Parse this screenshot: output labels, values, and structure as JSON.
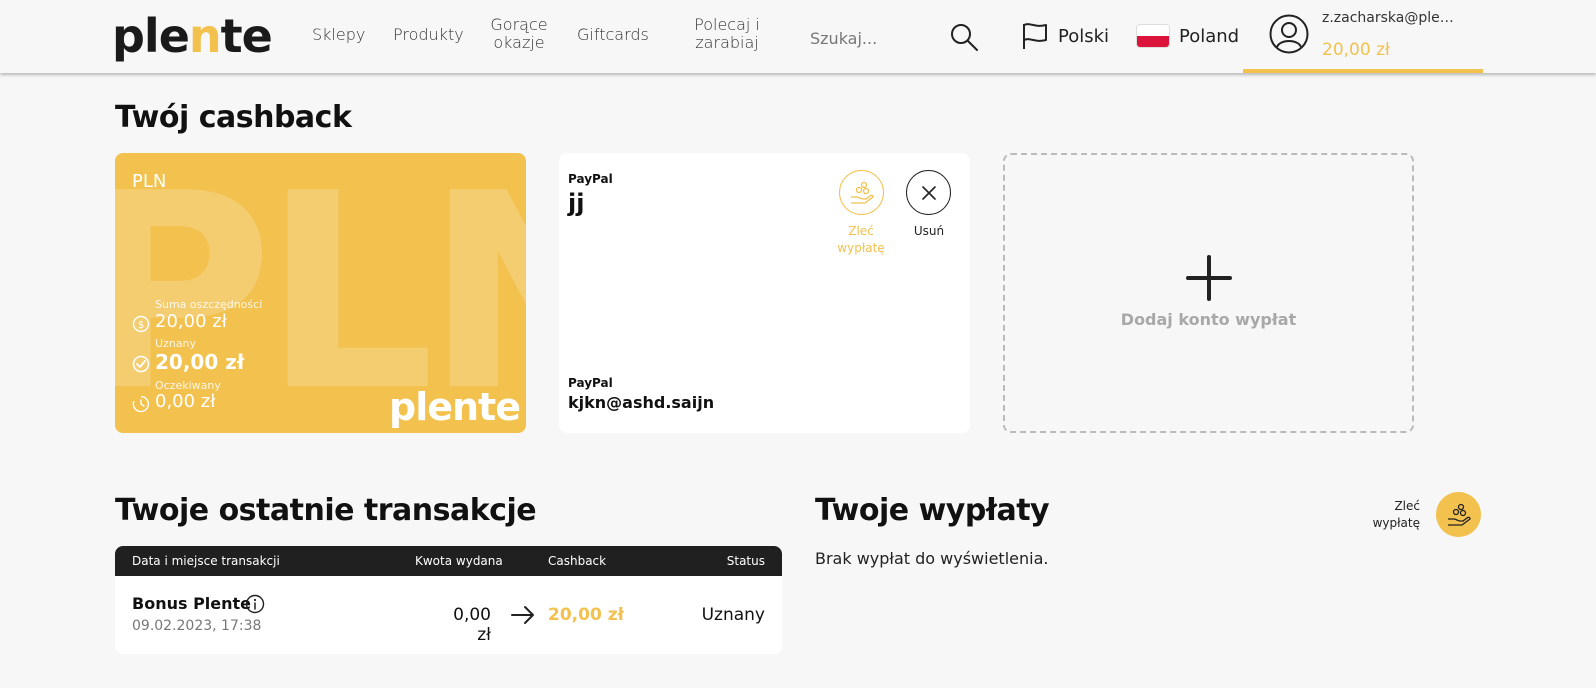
{
  "header": {
    "logo": {
      "pre": "ple",
      "accent": "n",
      "post": "te"
    },
    "nav": [
      {
        "label": "Sklepy"
      },
      {
        "label": "Produkty"
      },
      {
        "label": "Gorące okazje"
      },
      {
        "label": "Giftcards"
      },
      {
        "label": "Polecaj i zarabiaj"
      }
    ],
    "search_placeholder": "Szukaj...",
    "language": "Polski",
    "country": "Poland",
    "account": {
      "email": "z.zacharska@plente.com",
      "balance": "20,00 zł"
    }
  },
  "cashback": {
    "title": "Twój cashback",
    "card": {
      "currency": "PLN",
      "background_text": "PLN",
      "logo": "plente",
      "rows": [
        {
          "label": "Suma oszczędności",
          "value": "20,00 zł",
          "icon": "dollar-circle-icon"
        },
        {
          "label": "Uznany",
          "value": "20,00 zł",
          "icon": "check-circle-icon"
        },
        {
          "label": "Oczekiwany",
          "value": "0,00 zł",
          "icon": "clock-icon"
        }
      ]
    },
    "payout_account": {
      "type_label_top": "PayPal",
      "name": "jj",
      "type_label_bottom": "PayPal",
      "email": "kjkn@ashd.saijn",
      "request_label": "Zleć wypłatę",
      "delete_label": "Usuń"
    },
    "add_account_label": "Dodaj konto wypłat"
  },
  "transactions": {
    "title": "Twoje ostatnie transakcje",
    "columns": [
      "Data i miejsce transakcji",
      "Kwota wydana",
      "Cashback",
      "Status"
    ],
    "rows": [
      {
        "title": "Bonus Plente",
        "date": "09.02.2023, 17:38",
        "spent": "0,00 zł",
        "cashback": "20,00 zł",
        "status": "Uznany"
      }
    ]
  },
  "payouts": {
    "title": "Twoje wypłaty",
    "empty": "Brak wypłat do wyświetlenia.",
    "request_label": "Zleć wypłatę"
  },
  "colors": {
    "accent": "#f2c14e",
    "dark": "#202020",
    "background": "#f7f7f7"
  }
}
